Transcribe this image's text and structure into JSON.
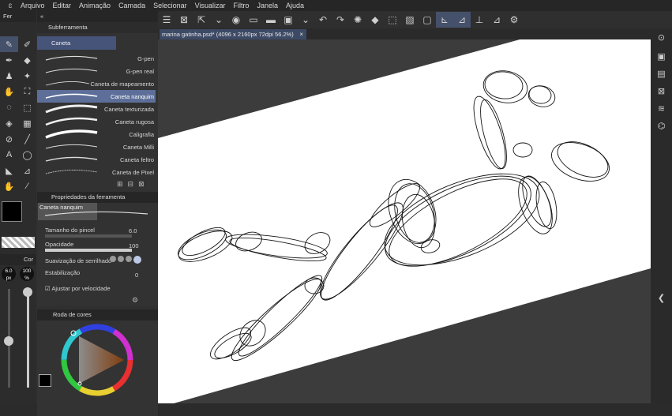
{
  "menu": [
    "Arquivo",
    "Editar",
    "Animação",
    "Camada",
    "Selecionar",
    "Visualizar",
    "Filtro",
    "Janela",
    "Ajuda"
  ],
  "tab": {
    "title": "marina gatinha.psd* (4096 x 2160px 72dpi 56.2%)",
    "close": "×"
  },
  "panels": {
    "tool_short": "Fer",
    "subtool": "Subferramenta",
    "subtool_group": "Caneta",
    "tool_props": "Propriedades da ferramenta",
    "color_wheel": "Roda de cores",
    "color_short": "Cor"
  },
  "brushes": [
    "G-pen",
    "G-pen real",
    "Caneta de mapeamento",
    "Caneta nanquim",
    "Caneta texturizada",
    "Caneta rugosa",
    "Caligrafia",
    "Caneta Milli",
    "Caneta feltro",
    "Caneta de Pixel"
  ],
  "selected_brush_index": 3,
  "tool_props": {
    "preset_name": "Caneta nanquim",
    "brush_size_label": "Tamanho do pincel",
    "brush_size_value": "6.0",
    "opacity_label": "Opacidade",
    "opacity_value": "100",
    "antialias_label": "Suavização de serrilhado",
    "stabilization_label": "Estabilização",
    "stabilization_value": "0",
    "speed_label": "Ajustar por velocidade"
  },
  "size_badge": {
    "size": "6.0",
    "size_unit": "px",
    "opacity": "100",
    "opacity_unit": "%"
  },
  "colors": {
    "accent": "#45506a",
    "selected_brush": "#5d6f99",
    "canvas": "#ffffff",
    "main_color": "#000000",
    "sub_color": "#ffffff"
  }
}
